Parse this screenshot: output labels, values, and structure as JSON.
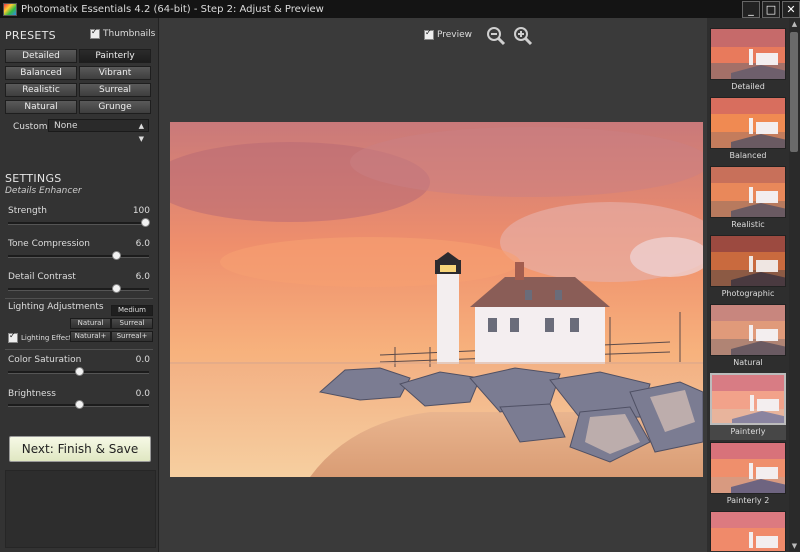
{
  "window": {
    "title": "Photomatix Essentials 4.2 (64-bit) - Step 2: Adjust & Preview",
    "minimize": "_",
    "maximize": "□",
    "close": "✕"
  },
  "presets": {
    "title": "PRESETS",
    "thumbnails_label": "Thumbnails",
    "buttons": [
      "Detailed",
      "Painterly",
      "Balanced",
      "Vibrant",
      "Realistic",
      "Surreal",
      "Natural",
      "Grunge"
    ],
    "active": "Painterly",
    "custom_label": "Custom:",
    "custom_value": "None"
  },
  "settings": {
    "title": "SETTINGS",
    "subtitle": "Details Enhancer",
    "sliders": [
      {
        "label": "Strength",
        "value": "100",
        "fraction": 1.0
      },
      {
        "label": "Tone Compression",
        "value": "6.0",
        "fraction": 0.78
      },
      {
        "label": "Detail Contrast",
        "value": "6.0",
        "fraction": 0.78
      }
    ],
    "lighting": {
      "label": "Lighting Adjustments",
      "effects_label": "Lighting Effects",
      "buttons": [
        "Medium",
        "Natural",
        "Surreal",
        "Natural+",
        "Surreal+"
      ],
      "active": "Medium"
    },
    "sliders2": [
      {
        "label": "Color Saturation",
        "value": "0.0",
        "fraction": 0.5
      },
      {
        "label": "Brightness",
        "value": "0.0",
        "fraction": 0.5
      }
    ]
  },
  "next_button": "Next: Finish & Save",
  "preview": {
    "label": "Preview"
  },
  "thumbnails": [
    "Detailed",
    "Balanced",
    "Realistic",
    "Photographic",
    "Natural",
    "Painterly",
    "Painterly 2",
    ""
  ],
  "active_thumbnail": "Painterly",
  "colors": {
    "accent_button": "#eef2d8",
    "panel": "#333333",
    "background": "#3a3a3a"
  }
}
